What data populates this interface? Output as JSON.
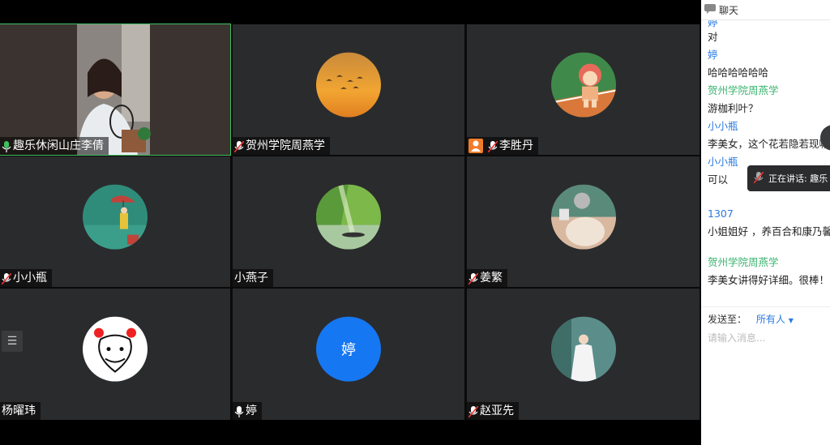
{
  "participants": [
    {
      "name": "趣乐休闲山庄李倩",
      "mic": "on"
    },
    {
      "name": "贺州学院周燕学",
      "mic": "muted"
    },
    {
      "name": "李胜丹",
      "mic": "muted"
    },
    {
      "name": "小小瓶",
      "mic": "muted"
    },
    {
      "name": "小燕子",
      "mic": "none"
    },
    {
      "name": "姜繁",
      "mic": "muted"
    },
    {
      "name": "杨曜玮",
      "mic": "none"
    },
    {
      "name": "婷",
      "mic": "on",
      "avatar_text": "婷"
    },
    {
      "name": "赵亚先",
      "mic": "muted"
    }
  ],
  "chat": {
    "title": "聊天",
    "top_partial_name": "婷",
    "messages": [
      {
        "sender": "",
        "text": "对"
      },
      {
        "sender": "婷",
        "sender_color": "#2a7ae2",
        "text": "哈哈哈哈哈哈"
      },
      {
        "sender": "贺州学院周燕学",
        "sender_color": "#3cb371",
        "text": "游枷利叶？"
      },
      {
        "sender": "小小瓶",
        "sender_color": "#2a7ae2",
        "text": "李美女，这个花若隐若现嘛"
      },
      {
        "sender": "小小瓶",
        "sender_color": "#2a7ae2",
        "text": "可以"
      },
      {
        "sender": "1307",
        "sender_color": "#2a7ae2",
        "text": "小姐姐好 ，养百合和康乃馨"
      },
      {
        "sender": "贺州学院周燕学",
        "sender_color": "#3cb371",
        "text": "李美女讲得好详细。很棒！"
      }
    ],
    "send_label": "发送至：",
    "send_target": "所有人",
    "input_placeholder": "请输入消息..."
  },
  "speaking": {
    "label": "正在讲话: 趣乐"
  },
  "colors": {
    "active_speaker": "#3fbf5f",
    "link_blue": "#2a7ae2",
    "green_name": "#3cb371"
  }
}
